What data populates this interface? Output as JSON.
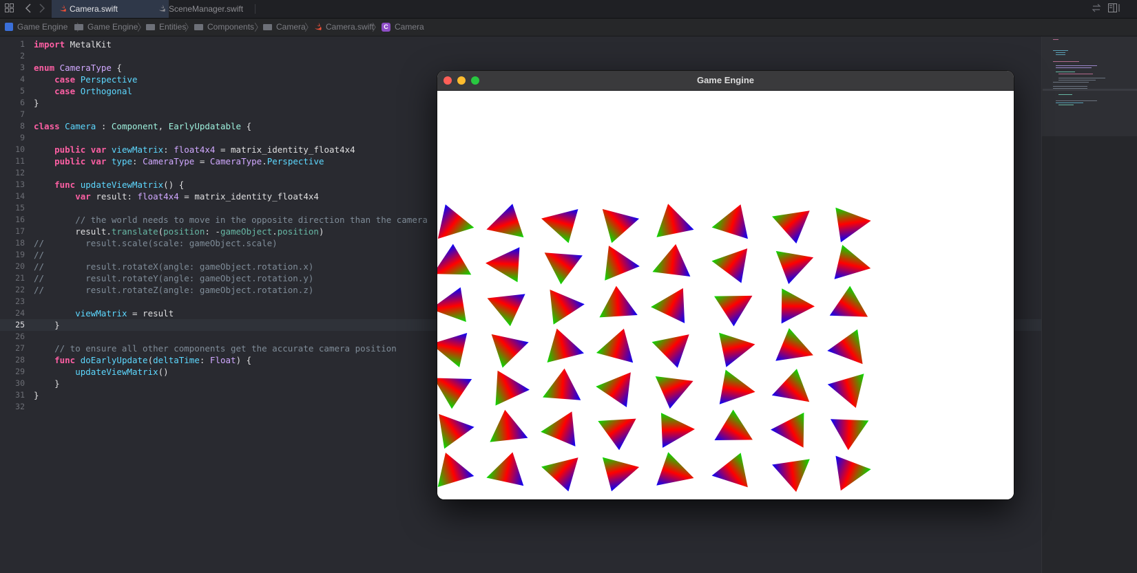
{
  "tabs": [
    {
      "label": "Camera.swift",
      "active": true
    },
    {
      "label": "SceneManager.swift",
      "active": false
    }
  ],
  "toolbar_icons": [
    "grid-icon",
    "back-arrow-icon",
    "forward-arrow-icon",
    "swap-icon",
    "inspector-icon"
  ],
  "breadcrumb": [
    "Game Engine",
    "Game Engine",
    "Entities",
    "Components",
    "Camera",
    "Camera.swift",
    "Camera"
  ],
  "code": {
    "current_line": 25,
    "lines": [
      {
        "n": "1",
        "text": "import MetalKit"
      },
      {
        "n": "2",
        "text": ""
      },
      {
        "n": "3",
        "text": "enum CameraType {"
      },
      {
        "n": "4",
        "text": "    case Perspective"
      },
      {
        "n": "5",
        "text": "    case Orthogonal"
      },
      {
        "n": "6",
        "text": "}"
      },
      {
        "n": "7",
        "text": ""
      },
      {
        "n": "8",
        "text": "class Camera : Component, EarlyUpdatable {"
      },
      {
        "n": "9",
        "text": ""
      },
      {
        "n": "10",
        "text": "    public var viewMatrix: float4x4 = matrix_identity_float4x4"
      },
      {
        "n": "11",
        "text": "    public var type: CameraType = CameraType.Perspective"
      },
      {
        "n": "12",
        "text": ""
      },
      {
        "n": "13",
        "text": "    func updateViewMatrix() {"
      },
      {
        "n": "14",
        "text": "        var result: float4x4 = matrix_identity_float4x4"
      },
      {
        "n": "15",
        "text": ""
      },
      {
        "n": "16",
        "text": "        // the world needs to move in the opposite direction than the camera"
      },
      {
        "n": "17",
        "text": "        result.translate(position: -gameObject.position)"
      },
      {
        "n": "18",
        "text": "//        result.scale(scale: gameObject.scale)"
      },
      {
        "n": "19",
        "text": "//"
      },
      {
        "n": "20",
        "text": "//        result.rotateX(angle: gameObject.rotation.x)"
      },
      {
        "n": "21",
        "text": "//        result.rotateY(angle: gameObject.rotation.y)"
      },
      {
        "n": "22",
        "text": "//        result.rotateZ(angle: gameObject.rotation.z)"
      },
      {
        "n": "23",
        "text": ""
      },
      {
        "n": "24",
        "text": "        viewMatrix = result"
      },
      {
        "n": "25",
        "text": "    }"
      },
      {
        "n": "26",
        "text": ""
      },
      {
        "n": "27",
        "text": "    // to ensure all other components get the accurate camera position"
      },
      {
        "n": "28",
        "text": "    func doEarlyUpdate(deltaTime: Float) {"
      },
      {
        "n": "29",
        "text": "        updateViewMatrix()"
      },
      {
        "n": "30",
        "text": "    }"
      },
      {
        "n": "31",
        "text": "}"
      },
      {
        "n": "32",
        "text": ""
      }
    ]
  },
  "game_window": {
    "title": "Game Engine",
    "traffic_lights": {
      "close": "#fe5f57",
      "minimize": "#febc2e",
      "zoom": "#28c840"
    },
    "triangle_colors": [
      "#ff0000",
      "#00e000",
      "#0000ff"
    ]
  },
  "colors": {
    "editor_bg": "#292a30",
    "keyword": "#fc5fa3",
    "type": "#5dd8ff",
    "comment": "#7f8c98"
  }
}
